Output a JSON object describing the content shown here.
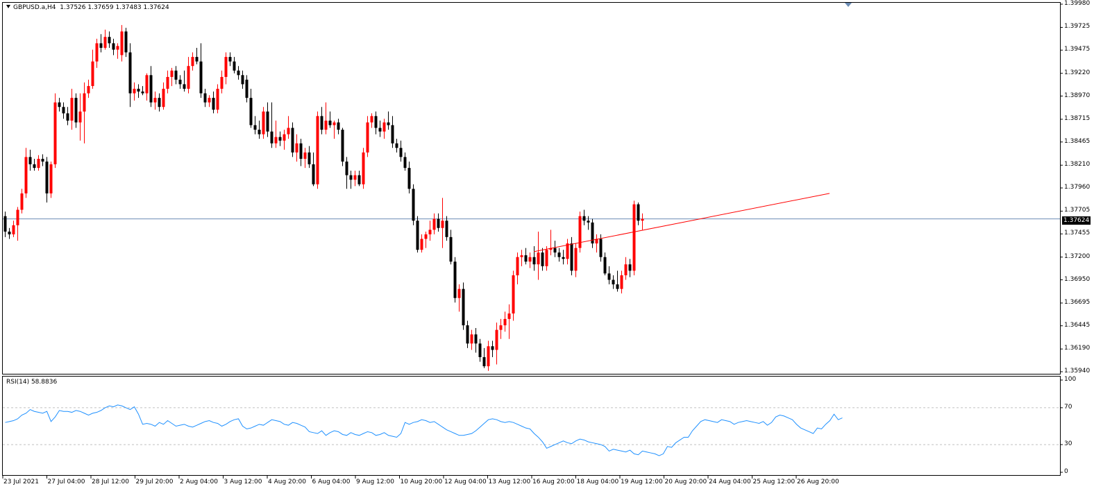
{
  "chart_title": {
    "symbol": "GBPUSD.a,H4",
    "ohlc": "1.37526 1.37659 1.37483 1.37624"
  },
  "colors": {
    "bull": "#ff0000",
    "bear": "#000000",
    "current_price_line": "#6b8cb5",
    "trendline": "#ff0000",
    "rsi_line": "#1e90ff"
  },
  "current_price_label": "1.37624",
  "rsi_label": "RSI(14) 58.8836",
  "chart_data": [
    {
      "type": "candlestick",
      "title": "GBPUSD.a,H4",
      "ylim": [
        1.3594,
        1.3998
      ],
      "y_ticks": [
        "1.39980",
        "1.39725",
        "1.39475",
        "1.39220",
        "1.38970",
        "1.38715",
        "1.38465",
        "1.38210",
        "1.37960",
        "1.37705",
        "1.37455",
        "1.37200",
        "1.36950",
        "1.36695",
        "1.36445",
        "1.36190",
        "1.35940"
      ],
      "x_ticks": [
        "23 Jul 2021",
        "27 Jul 04:00",
        "28 Jul 12:00",
        "29 Jul 20:00",
        "2 Aug 04:00",
        "3 Aug 12:00",
        "4 Aug 20:00",
        "6 Aug 04:00",
        "9 Aug 12:00",
        "10 Aug 20:00",
        "12 Aug 04:00",
        "13 Aug 12:00",
        "16 Aug 20:00",
        "18 Aug 04:00",
        "19 Aug 12:00",
        "20 Aug 20:00",
        "24 Aug 04:00",
        "25 Aug 12:00",
        "26 Aug 20:00"
      ],
      "current_price": 1.37624,
      "ohlc": [
        [
          1.3765,
          1.377,
          1.3742,
          1.3748
        ],
        [
          1.3748,
          1.3752,
          1.374,
          1.3745
        ],
        [
          1.3745,
          1.376,
          1.3742,
          1.3755
        ],
        [
          1.3755,
          1.3775,
          1.3738,
          1.3772
        ],
        [
          1.3772,
          1.3795,
          1.3768,
          1.379
        ],
        [
          1.379,
          1.384,
          1.3785,
          1.383
        ],
        [
          1.383,
          1.3838,
          1.3815,
          1.3822
        ],
        [
          1.3822,
          1.3828,
          1.3815,
          1.3818
        ],
        [
          1.3818,
          1.3832,
          1.3815,
          1.3828
        ],
        [
          1.3828,
          1.3833,
          1.382,
          1.3825
        ],
        [
          1.3825,
          1.383,
          1.378,
          1.379
        ],
        [
          1.379,
          1.3825,
          1.3785,
          1.3822
        ],
        [
          1.3822,
          1.39,
          1.3818,
          1.389
        ],
        [
          1.389,
          1.3895,
          1.388,
          1.3885
        ],
        [
          1.3885,
          1.389,
          1.3872,
          1.3878
        ],
        [
          1.3878,
          1.3885,
          1.3865,
          1.387
        ],
        [
          1.387,
          1.3905,
          1.386,
          1.3895
        ],
        [
          1.3895,
          1.39,
          1.3862,
          1.3868
        ],
        [
          1.3868,
          1.39,
          1.3848,
          1.388
        ],
        [
          1.388,
          1.3912,
          1.3845,
          1.39
        ],
        [
          1.39,
          1.3915,
          1.3895,
          1.3908
        ],
        [
          1.3908,
          1.3948,
          1.3905,
          1.3935
        ],
        [
          1.3935,
          1.396,
          1.3928,
          1.3955
        ],
        [
          1.3955,
          1.3965,
          1.3945,
          1.395
        ],
        [
          1.395,
          1.397,
          1.3948,
          1.3962
        ],
        [
          1.3962,
          1.3968,
          1.395,
          1.3955
        ],
        [
          1.3955,
          1.396,
          1.3942,
          1.3948
        ],
        [
          1.3948,
          1.3955,
          1.3938,
          1.3952
        ],
        [
          1.3942,
          1.3975,
          1.3935,
          1.3968
        ],
        [
          1.3968,
          1.3972,
          1.394,
          1.3945
        ],
        [
          1.3945,
          1.3955,
          1.3885,
          1.39
        ],
        [
          1.39,
          1.3912,
          1.3892,
          1.3905
        ],
        [
          1.3905,
          1.391,
          1.3895,
          1.3902
        ],
        [
          1.3902,
          1.3908,
          1.3898,
          1.39
        ],
        [
          1.39,
          1.3922,
          1.3892,
          1.392
        ],
        [
          1.392,
          1.393,
          1.3885,
          1.389
        ],
        [
          1.389,
          1.3902,
          1.3882,
          1.3895
        ],
        [
          1.3895,
          1.39,
          1.388,
          1.3885
        ],
        [
          1.3885,
          1.3912,
          1.3882,
          1.3905
        ],
        [
          1.3905,
          1.3925,
          1.39,
          1.3918
        ],
        [
          1.3918,
          1.3928,
          1.3908,
          1.3925
        ],
        [
          1.3925,
          1.393,
          1.391,
          1.3915
        ],
        [
          1.3915,
          1.392,
          1.3905,
          1.391
        ],
        [
          1.391,
          1.3925,
          1.3902,
          1.3905
        ],
        [
          1.3905,
          1.394,
          1.39,
          1.393
        ],
        [
          1.393,
          1.3945,
          1.3925,
          1.394
        ],
        [
          1.394,
          1.395,
          1.3932,
          1.3935
        ],
        [
          1.3935,
          1.3955,
          1.3895,
          1.39
        ],
        [
          1.39,
          1.3905,
          1.3885,
          1.389
        ],
        [
          1.389,
          1.3898,
          1.3885,
          1.3895
        ],
        [
          1.3895,
          1.3902,
          1.3878,
          1.3882
        ],
        [
          1.3882,
          1.391,
          1.3878,
          1.3905
        ],
        [
          1.3905,
          1.3925,
          1.39,
          1.3918
        ],
        [
          1.3918,
          1.3945,
          1.391,
          1.394
        ],
        [
          1.394,
          1.3945,
          1.393,
          1.3935
        ],
        [
          1.3935,
          1.394,
          1.3922,
          1.3925
        ],
        [
          1.3925,
          1.393,
          1.3915,
          1.392
        ],
        [
          1.392,
          1.3925,
          1.3905,
          1.391
        ],
        [
          1.3915,
          1.392,
          1.389,
          1.3895
        ],
        [
          1.3895,
          1.3905,
          1.3862,
          1.3865
        ],
        [
          1.3865,
          1.3875,
          1.3855,
          1.386
        ],
        [
          1.386,
          1.387,
          1.385,
          1.3855
        ],
        [
          1.3855,
          1.3885,
          1.385,
          1.388
        ],
        [
          1.388,
          1.389,
          1.3852,
          1.3858
        ],
        [
          1.3858,
          1.389,
          1.384,
          1.3845
        ],
        [
          1.3845,
          1.387,
          1.384,
          1.3852
        ],
        [
          1.3852,
          1.3858,
          1.3842,
          1.3848
        ],
        [
          1.3848,
          1.386,
          1.3838,
          1.3855
        ],
        [
          1.3855,
          1.3875,
          1.385,
          1.3862
        ],
        [
          1.3862,
          1.3868,
          1.383,
          1.3835
        ],
        [
          1.3835,
          1.3855,
          1.3825,
          1.3845
        ],
        [
          1.3845,
          1.385,
          1.382,
          1.3828
        ],
        [
          1.3828,
          1.384,
          1.3818,
          1.3835
        ],
        [
          1.3835,
          1.3842,
          1.3818,
          1.3822
        ],
        [
          1.3822,
          1.3835,
          1.3798,
          1.38
        ],
        [
          1.38,
          1.388,
          1.3795,
          1.3875
        ],
        [
          1.3875,
          1.3885,
          1.3855,
          1.386
        ],
        [
          1.386,
          1.389,
          1.3855,
          1.387
        ],
        [
          1.387,
          1.388,
          1.3862,
          1.3865
        ],
        [
          1.3865,
          1.387,
          1.385,
          1.3868
        ],
        [
          1.3868,
          1.3872,
          1.3855,
          1.386
        ],
        [
          1.386,
          1.3862,
          1.382,
          1.3825
        ],
        [
          1.3825,
          1.383,
          1.3795,
          1.381
        ],
        [
          1.381,
          1.3815,
          1.3795,
          1.3805
        ],
        [
          1.3805,
          1.3815,
          1.3798,
          1.381
        ],
        [
          1.381,
          1.3815,
          1.3798,
          1.38
        ],
        [
          1.38,
          1.384,
          1.3795,
          1.3835
        ],
        [
          1.3835,
          1.3875,
          1.383,
          1.3868
        ],
        [
          1.3868,
          1.3878,
          1.3862,
          1.3875
        ],
        [
          1.3875,
          1.388,
          1.3855,
          1.3862
        ],
        [
          1.3862,
          1.387,
          1.3852,
          1.3858
        ],
        [
          1.3858,
          1.3872,
          1.385,
          1.3868
        ],
        [
          1.3868,
          1.388,
          1.386,
          1.3865
        ],
        [
          1.3865,
          1.3875,
          1.384,
          1.3845
        ],
        [
          1.3845,
          1.385,
          1.3835,
          1.384
        ],
        [
          1.384,
          1.3848,
          1.3825,
          1.383
        ],
        [
          1.383,
          1.3835,
          1.3815,
          1.3818
        ],
        [
          1.3818,
          1.3825,
          1.379,
          1.3795
        ],
        [
          1.3795,
          1.38,
          1.3755,
          1.376
        ],
        [
          1.376,
          1.3765,
          1.3725,
          1.3728
        ],
        [
          1.3728,
          1.3745,
          1.3725,
          1.374
        ],
        [
          1.374,
          1.3748,
          1.373,
          1.3745
        ],
        [
          1.3745,
          1.376,
          1.3738,
          1.375
        ],
        [
          1.375,
          1.3768,
          1.3745,
          1.3762
        ],
        [
          1.3762,
          1.3768,
          1.3748,
          1.3752
        ],
        [
          1.3752,
          1.3785,
          1.373,
          1.376
        ],
        [
          1.376,
          1.3765,
          1.3738,
          1.3742
        ],
        [
          1.3742,
          1.375,
          1.3712,
          1.3715
        ],
        [
          1.3715,
          1.372,
          1.367,
          1.3675
        ],
        [
          1.3675,
          1.369,
          1.366,
          1.3685
        ],
        [
          1.3685,
          1.3692,
          1.364,
          1.3645
        ],
        [
          1.3645,
          1.365,
          1.362,
          1.3625
        ],
        [
          1.3625,
          1.364,
          1.3618,
          1.3635
        ],
        [
          1.3635,
          1.3642,
          1.3615,
          1.3625
        ],
        [
          1.3625,
          1.363,
          1.3605,
          1.361
        ],
        [
          1.361,
          1.362,
          1.3598,
          1.36
        ],
        [
          1.36,
          1.3628,
          1.3595,
          1.3622
        ],
        [
          1.3622,
          1.3628,
          1.361,
          1.3618
        ],
        [
          1.3618,
          1.3648,
          1.3602,
          1.364
        ],
        [
          1.364,
          1.3652,
          1.363,
          1.3645
        ],
        [
          1.3645,
          1.366,
          1.3638,
          1.3652
        ],
        [
          1.3652,
          1.3668,
          1.363,
          1.3658
        ],
        [
          1.3658,
          1.3705,
          1.365,
          1.37
        ],
        [
          1.37,
          1.3725,
          1.369,
          1.372
        ],
        [
          1.372,
          1.3728,
          1.371,
          1.3722
        ],
        [
          1.3722,
          1.373,
          1.3712,
          1.3715
        ],
        [
          1.3715,
          1.3725,
          1.3708,
          1.372
        ],
        [
          1.372,
          1.3732,
          1.3705,
          1.3712
        ],
        [
          1.3712,
          1.3748,
          1.3695,
          1.3725
        ],
        [
          1.3725,
          1.373,
          1.3705,
          1.371
        ],
        [
          1.371,
          1.3732,
          1.3705,
          1.3728
        ],
        [
          1.3728,
          1.375,
          1.3722,
          1.373
        ],
        [
          1.373,
          1.3738,
          1.372,
          1.3725
        ],
        [
          1.3725,
          1.373,
          1.3715,
          1.372
        ],
        [
          1.372,
          1.3728,
          1.3712,
          1.3718
        ],
        [
          1.3718,
          1.374,
          1.3712,
          1.3735
        ],
        [
          1.3735,
          1.3742,
          1.37,
          1.3705
        ],
        [
          1.3705,
          1.3735,
          1.3698,
          1.373
        ],
        [
          1.373,
          1.377,
          1.3725,
          1.3765
        ],
        [
          1.3765,
          1.3772,
          1.3755,
          1.376
        ],
        [
          1.376,
          1.3765,
          1.375,
          1.3758
        ],
        [
          1.3758,
          1.3762,
          1.373,
          1.3735
        ],
        [
          1.3735,
          1.3745,
          1.3725,
          1.374
        ],
        [
          1.374,
          1.3745,
          1.3715,
          1.372
        ],
        [
          1.372,
          1.3725,
          1.37,
          1.3702
        ],
        [
          1.3702,
          1.371,
          1.369,
          1.3695
        ],
        [
          1.3695,
          1.37,
          1.3685,
          1.369
        ],
        [
          1.369,
          1.3705,
          1.3682,
          1.3685
        ],
        [
          1.3685,
          1.3705,
          1.368,
          1.37
        ],
        [
          1.37,
          1.372,
          1.3695,
          1.3712
        ],
        [
          1.3712,
          1.3718,
          1.3698,
          1.3705
        ],
        [
          1.3705,
          1.3782,
          1.37,
          1.3778
        ],
        [
          1.3778,
          1.378,
          1.3755,
          1.376
        ],
        [
          1.376,
          1.3768,
          1.375,
          1.3762
        ]
      ],
      "trendline": {
        "from": {
          "bar": 127,
          "price": 1.3726
        },
        "to": {
          "bar": 198,
          "price": 1.379
        }
      },
      "subchart": {
        "name": "RSI(14)",
        "value": 58.8836,
        "ylim": [
          0,
          100
        ],
        "levels": [
          70,
          30
        ],
        "y_ticks": [
          "100",
          "70",
          "30",
          "0"
        ],
        "values": [
          54,
          55,
          56,
          58,
          62,
          64,
          68,
          66,
          65,
          64,
          66,
          55,
          60,
          67,
          66,
          66,
          65,
          67,
          66,
          64,
          62,
          64,
          65,
          67,
          70,
          72,
          71,
          73,
          72,
          70,
          68,
          71,
          63,
          52,
          53,
          52,
          50,
          54,
          52,
          56,
          53,
          50,
          51,
          52,
          50,
          49,
          51,
          53,
          55,
          56,
          54,
          53,
          50,
          52,
          55,
          57,
          58,
          50,
          47,
          48,
          50,
          52,
          51,
          54,
          57,
          56,
          55,
          52,
          51,
          54,
          53,
          51,
          49,
          44,
          43,
          42,
          45,
          40,
          43,
          45,
          44,
          41,
          40,
          43,
          41,
          40,
          42,
          44,
          43,
          40,
          41,
          43,
          40,
          39,
          38,
          42,
          54,
          52,
          54,
          55,
          57,
          56,
          54,
          55,
          52,
          49,
          46,
          44,
          42,
          40,
          40,
          41,
          42,
          45,
          49,
          53,
          57,
          58,
          57,
          55,
          54,
          55,
          54,
          52,
          50,
          48,
          47,
          42,
          38,
          33,
          26,
          28,
          30,
          32,
          34,
          32,
          31,
          34,
          36,
          35,
          33,
          32,
          31,
          30,
          28,
          23,
          25,
          24,
          23,
          22,
          24,
          20,
          19,
          23,
          22,
          21,
          20,
          18,
          20,
          28,
          27,
          32,
          35,
          38,
          38,
          45,
          50,
          55,
          57,
          56,
          55,
          54,
          57,
          56,
          55,
          52,
          54,
          55,
          56,
          55,
          54,
          53,
          55,
          51,
          54,
          60,
          62,
          61,
          59,
          57,
          52,
          48,
          46,
          44,
          42,
          48,
          47,
          52,
          56,
          63,
          57,
          59
        ]
      }
    }
  ]
}
